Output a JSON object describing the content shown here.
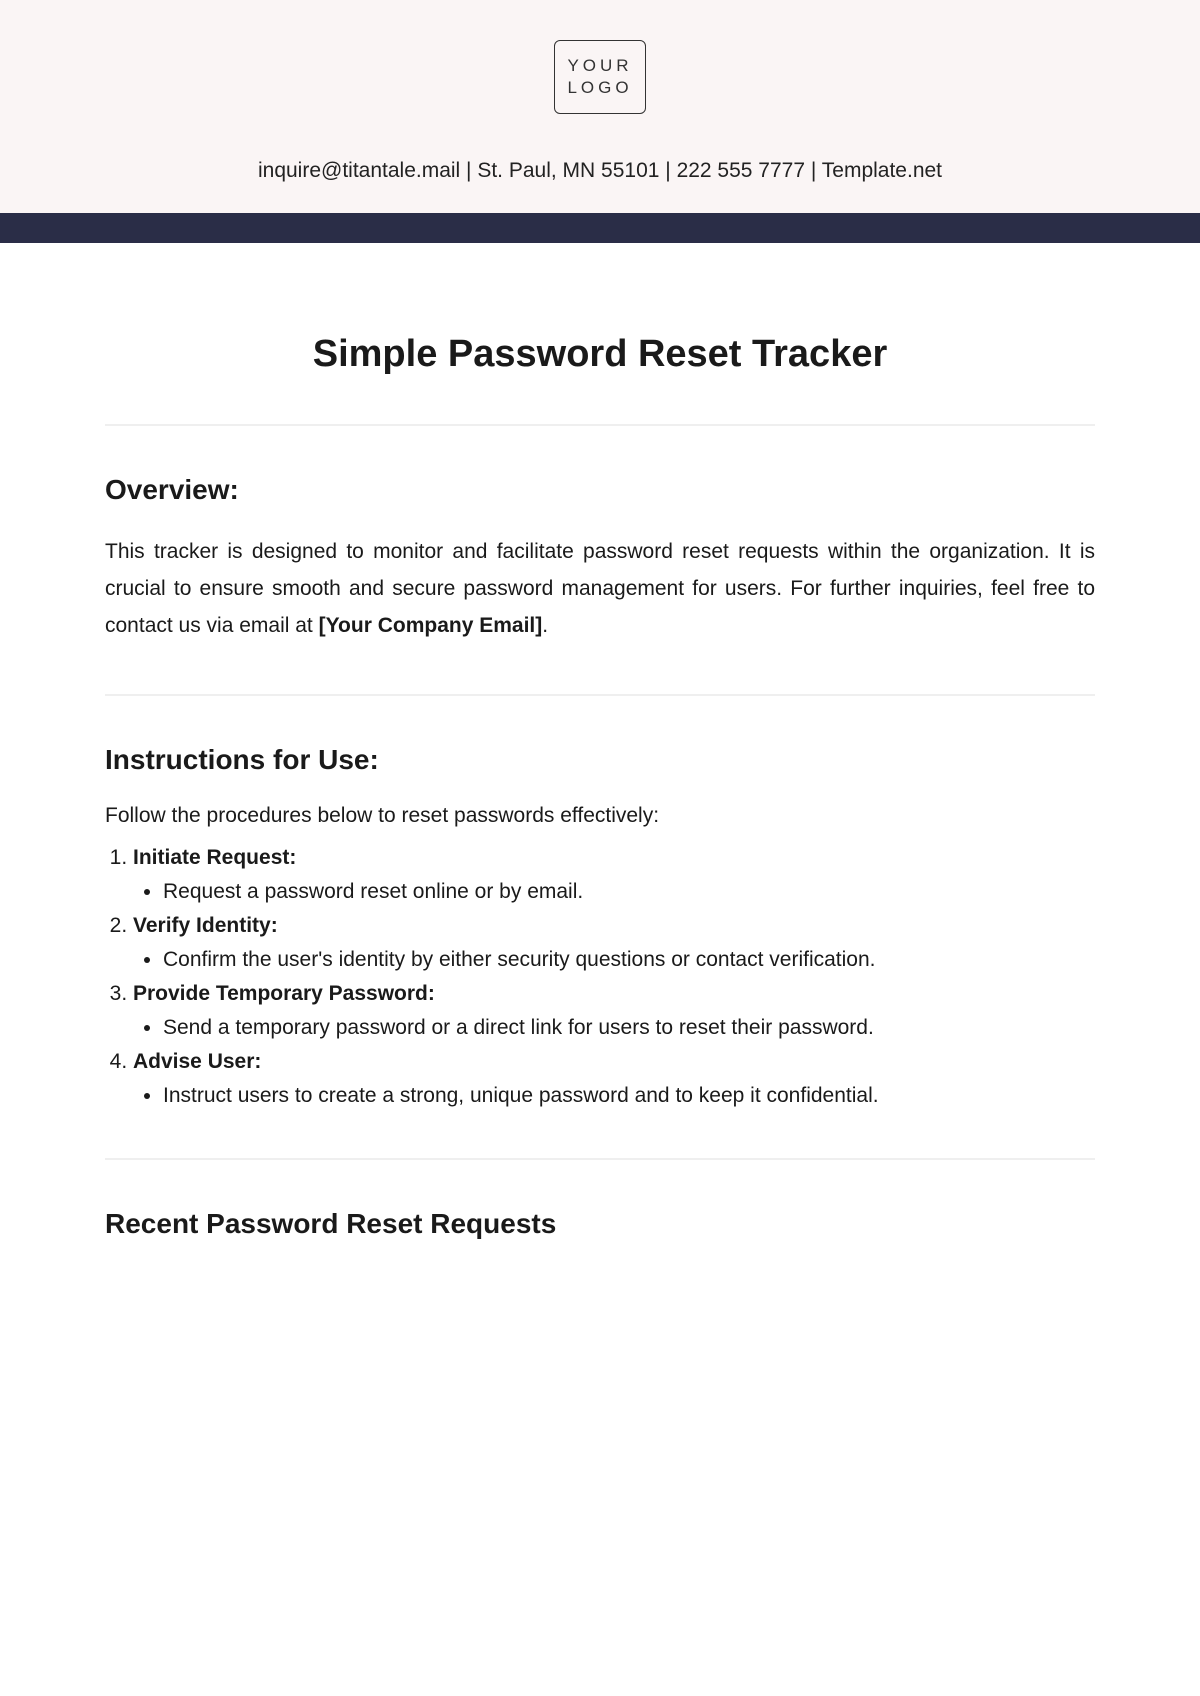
{
  "header": {
    "logo_line1": "YOUR",
    "logo_line2": "LOGO",
    "contact": "inquire@titantale.mail | St. Paul, MN 55101 | 222 555 7777 | Template.net"
  },
  "title": "Simple Password Reset Tracker",
  "overview": {
    "heading": "Overview:",
    "text_before_bold": "This tracker is designed to monitor and facilitate password reset requests within the organization. It is crucial to ensure smooth and secure password management for users. For further inquiries, feel free to contact us via email at ",
    "bold_text": "[Your Company Email]",
    "text_after_bold": "."
  },
  "instructions": {
    "heading": "Instructions for Use:",
    "intro": "Follow the procedures below to reset passwords effectively:",
    "steps": [
      {
        "title": "Initiate Request:",
        "detail": "Request a password reset online or by email."
      },
      {
        "title": "Verify Identity:",
        "detail": "Confirm the user's identity by either security questions or contact verification."
      },
      {
        "title": "Provide Temporary Password:",
        "detail": "Send a temporary password or a direct link for users to reset their password."
      },
      {
        "title": "Advise User:",
        "detail": "Instruct users to create a strong, unique password and to keep it confidential."
      }
    ]
  },
  "recent": {
    "heading": "Recent Password Reset Requests"
  }
}
